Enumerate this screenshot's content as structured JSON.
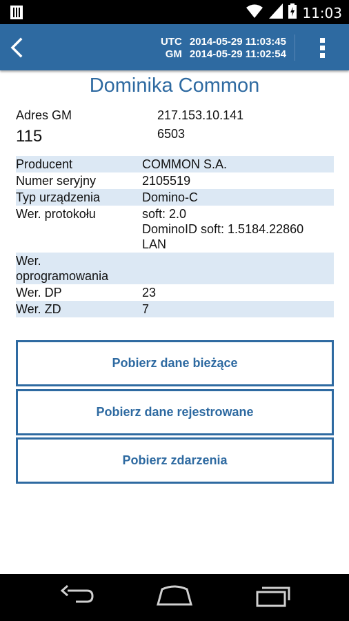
{
  "status_bar": {
    "time": "11:03",
    "icons": [
      "sim-card-icon",
      "wifi-icon",
      "cellular-signal-icon",
      "battery-charging-icon"
    ]
  },
  "action_bar": {
    "back_icon": "chevron-left-icon",
    "utc_label": "UTC",
    "utc_value": "2014-05-29 11:03:45",
    "gm_label": "GM",
    "gm_value": "2014-05-29 11:02:54",
    "menu_icon": "overflow-menu-icon"
  },
  "device": {
    "title": "Dominika Common",
    "address_label": "Adres GM",
    "address_number": "115",
    "ip": "217.153.10.141",
    "port": "6503"
  },
  "info_rows": [
    {
      "key": "Producent",
      "value": "COMMON S.A."
    },
    {
      "key": "Numer seryjny",
      "value": "2105519"
    },
    {
      "key": "Typ urządzenia",
      "value": "Domino-C"
    },
    {
      "key": "Wer. protokołu",
      "value": "soft: 2.0\nDominoID soft: 1.5184.22860\nLAN"
    },
    {
      "key": "Wer.\noprogramowania",
      "value": ""
    },
    {
      "key": "Wer. DP",
      "value": "23"
    },
    {
      "key": "Wer. ZD",
      "value": "7"
    }
  ],
  "buttons": {
    "current_data": "Pobierz dane bieżące",
    "recorded_data": "Pobierz dane rejestrowane",
    "events": "Pobierz zdarzenia"
  },
  "colors": {
    "accent": "#2e6aa1",
    "row_highlight": "#dce8f4",
    "bars": "#000000"
  },
  "nav_bar": {
    "icons": [
      "back-nav-icon",
      "home-nav-icon",
      "recent-apps-icon"
    ]
  }
}
